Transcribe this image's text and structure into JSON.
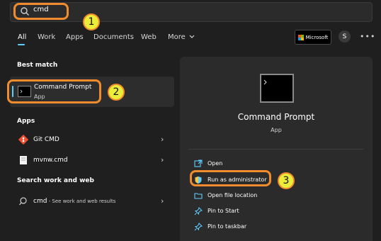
{
  "search": {
    "query": "cmd"
  },
  "filters": [
    {
      "label": "All",
      "active": true
    },
    {
      "label": "Work"
    },
    {
      "label": "Apps"
    },
    {
      "label": "Documents"
    },
    {
      "label": "Web"
    },
    {
      "label": "More"
    }
  ],
  "account": {
    "brand": "Microsoft",
    "avatar_letter": "S",
    "more": "•••"
  },
  "best_match": {
    "heading": "Best match",
    "name": "Command Prompt",
    "type": "App"
  },
  "apps": {
    "heading": "Apps",
    "items": [
      {
        "label": "Git CMD"
      },
      {
        "label": "mvnw.cmd"
      }
    ]
  },
  "web": {
    "heading": "Search work and web",
    "query": "cmd",
    "suffix": " - See work and web results"
  },
  "detail": {
    "title": "Command Prompt",
    "type": "App",
    "actions": [
      {
        "label": "Open",
        "icon": "open-icon"
      },
      {
        "label": "Run as administrator",
        "icon": "shield-icon"
      },
      {
        "label": "Open file location",
        "icon": "folder-icon"
      },
      {
        "label": "Pin to Start",
        "icon": "pin-icon"
      },
      {
        "label": "Pin to taskbar",
        "icon": "pin-icon"
      }
    ]
  },
  "annotations": [
    "1",
    "2",
    "3"
  ],
  "colors": {
    "accent": "#60cdff",
    "highlight": "#f08c2d",
    "badge": "#ecec3a"
  }
}
